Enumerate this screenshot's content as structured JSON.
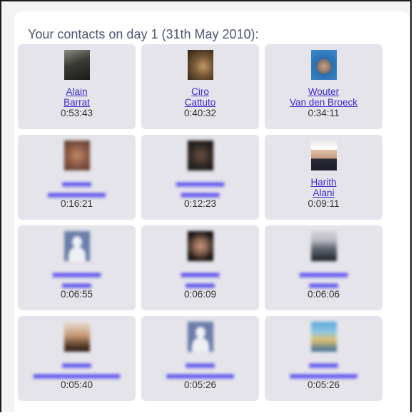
{
  "heading": "Your contacts on day 1 (31th May 2010):",
  "contacts": [
    {
      "first": "Alain",
      "last": "Barrat",
      "time": "0:53:43",
      "avatar_icon": "profile-photo-icon"
    },
    {
      "first": "Ciro",
      "last": "Cattuto",
      "time": "0:40:32",
      "avatar_icon": "profile-photo-icon"
    },
    {
      "first": "Wouter",
      "last": "Van den Broeck",
      "time": "0:34:11",
      "avatar_icon": "profile-photo-icon"
    },
    {
      "first": "",
      "last": "",
      "time": "0:16:21",
      "avatar_icon": "blurred-profile-photo-icon"
    },
    {
      "first": "",
      "last": "",
      "time": "0:12:23",
      "avatar_icon": "blurred-profile-photo-icon"
    },
    {
      "first": "Harith",
      "last": "Alani",
      "time": "0:09:11",
      "avatar_icon": "profile-photo-icon"
    },
    {
      "first": "",
      "last": "",
      "time": "0:06:55",
      "avatar_icon": "default-silhouette-icon"
    },
    {
      "first": "",
      "last": "",
      "time": "0:06:09",
      "avatar_icon": "blurred-profile-photo-icon"
    },
    {
      "first": "",
      "last": "",
      "time": "0:06:06",
      "avatar_icon": "blurred-profile-photo-icon"
    },
    {
      "first": "",
      "last": "",
      "time": "0:05:40",
      "avatar_icon": "blurred-profile-photo-icon"
    },
    {
      "first": "",
      "last": "",
      "time": "0:05:26",
      "avatar_icon": "default-silhouette-icon"
    },
    {
      "first": "",
      "last": "",
      "time": "0:05:26",
      "avatar_icon": "blurred-profile-photo-icon"
    }
  ],
  "colors": {
    "link": "#3f2ad0",
    "card": "#e4e4ea",
    "heading": "#4f5670"
  }
}
